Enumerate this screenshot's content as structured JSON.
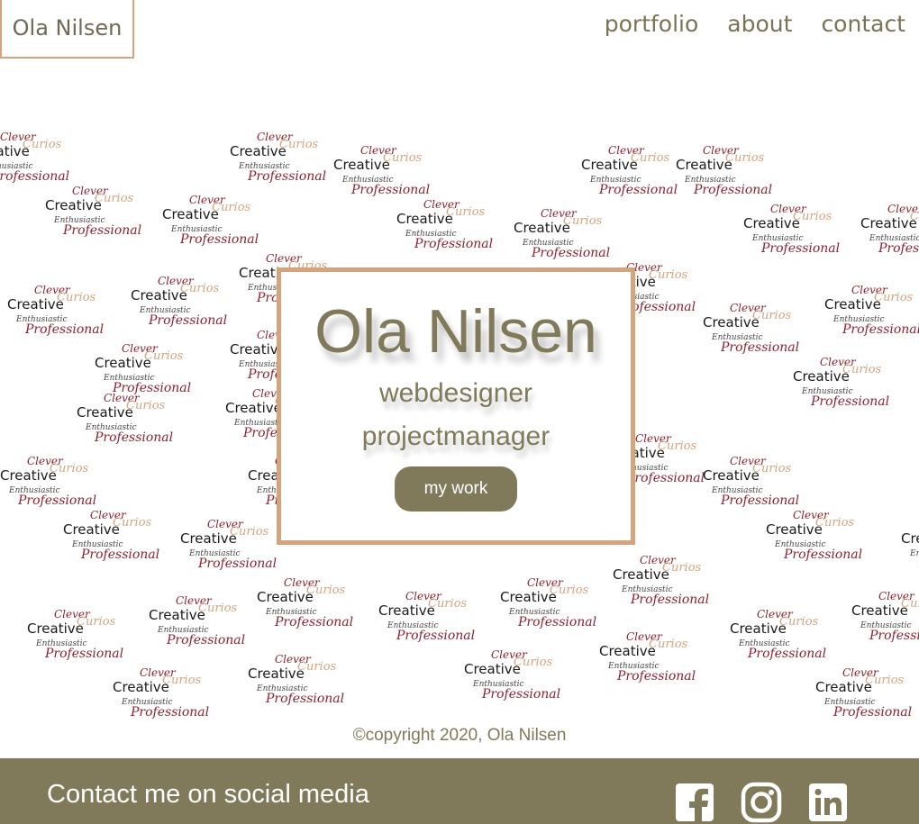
{
  "header": {
    "logo": "Ola Nilsen",
    "nav": [
      "portfolio",
      "about",
      "contact"
    ]
  },
  "pattern_words": {
    "clever": "Clever",
    "creative": "Creative",
    "curios": "Curios",
    "enthusiastic": "Enthusiastic",
    "professional": "Professional"
  },
  "hero": {
    "name": "Ola Nilsen",
    "role1": "webdesigner",
    "role2": "projectmanager",
    "button": "my work"
  },
  "copyright": "©copyright 2020, Ola Nilsen",
  "footer": {
    "text": "Contact me on social media",
    "icons": [
      "facebook-icon",
      "instagram-icon",
      "linkedin-icon"
    ]
  },
  "colors": {
    "accent": "#d4a47e",
    "primary": "#807a5a",
    "word_red": "#8b2330"
  }
}
